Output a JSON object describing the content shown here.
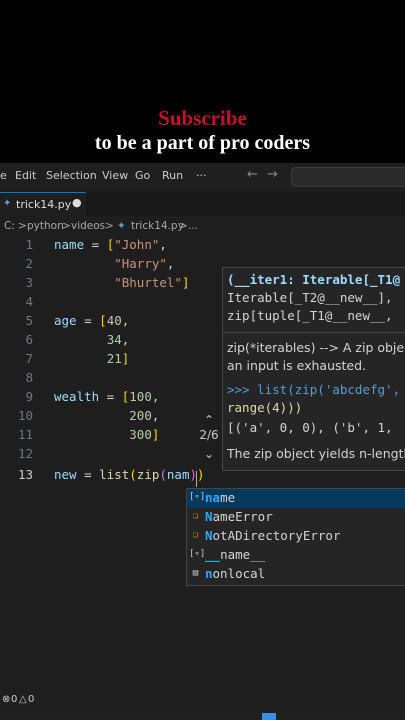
{
  "banner": {
    "title": "Subscribe",
    "subtitle": "to be a part of pro coders"
  },
  "menubar": {
    "items": [
      "e",
      "Edit",
      "Selection",
      "View",
      "Go",
      "Run",
      "···"
    ],
    "back_icon": "arrow-left-icon",
    "forward_icon": "arrow-right-icon"
  },
  "tab": {
    "filename": "trick14.py",
    "dirty_marker": "●"
  },
  "breadcrumb": {
    "parts": [
      "C:",
      ">",
      "python",
      ">",
      "videos",
      ">",
      "trick14.py",
      ">",
      "..."
    ]
  },
  "editor": {
    "line_numbers": [
      "1",
      "2",
      "3",
      "4",
      "5",
      "6",
      "7",
      "8",
      "9",
      "10",
      "11",
      "12",
      "13"
    ],
    "active_line": "13",
    "lines": [
      "name = [\"John\",",
      "        \"Harry\",",
      "        \"Bhurtel\"]",
      "",
      "age = [40,",
      "       34,",
      "       21]",
      "",
      "wealth = [100,",
      "          200,",
      "          300]",
      "",
      "new = list(zip(nam))"
    ]
  },
  "hover": {
    "sig1": "(__iter1: Iterable[_T1@",
    "sig2": "Iterable[_T2@__new__],",
    "sig3": "zip[tuple[_T1@__new__, ",
    "doc1": "zip(*iterables) --> A zip objec",
    "doc2": "an input is exhausted.",
    "ex1": ">>> list(zip('abcdefg', ",
    "ex2": "range(4)))",
    "ex3": "[('a', 0, 0), ('b', 1, ",
    "doc3": "The zip object yields n-length"
  },
  "overload_counter": "2/6",
  "suggestions": [
    {
      "match": "na",
      "rest": "me",
      "icon": "variable-icon",
      "selected": true
    },
    {
      "match": "N",
      "rest": "ameError",
      "icon": "class-icon",
      "selected": false
    },
    {
      "match": "N",
      "rest": "otADirectoryError",
      "icon": "class-icon",
      "selected": false
    },
    {
      "match": "__",
      "rest": "name__",
      "icon": "variable-icon",
      "selected": false
    },
    {
      "match": "n",
      "rest": "onlocal",
      "icon": "keyword-icon",
      "selected": false
    }
  ],
  "status": {
    "errors": "0",
    "warnings": "0"
  },
  "colors": {
    "accent": "#0078d4",
    "subscribe": "#c8102e",
    "selection": "#04395e"
  }
}
